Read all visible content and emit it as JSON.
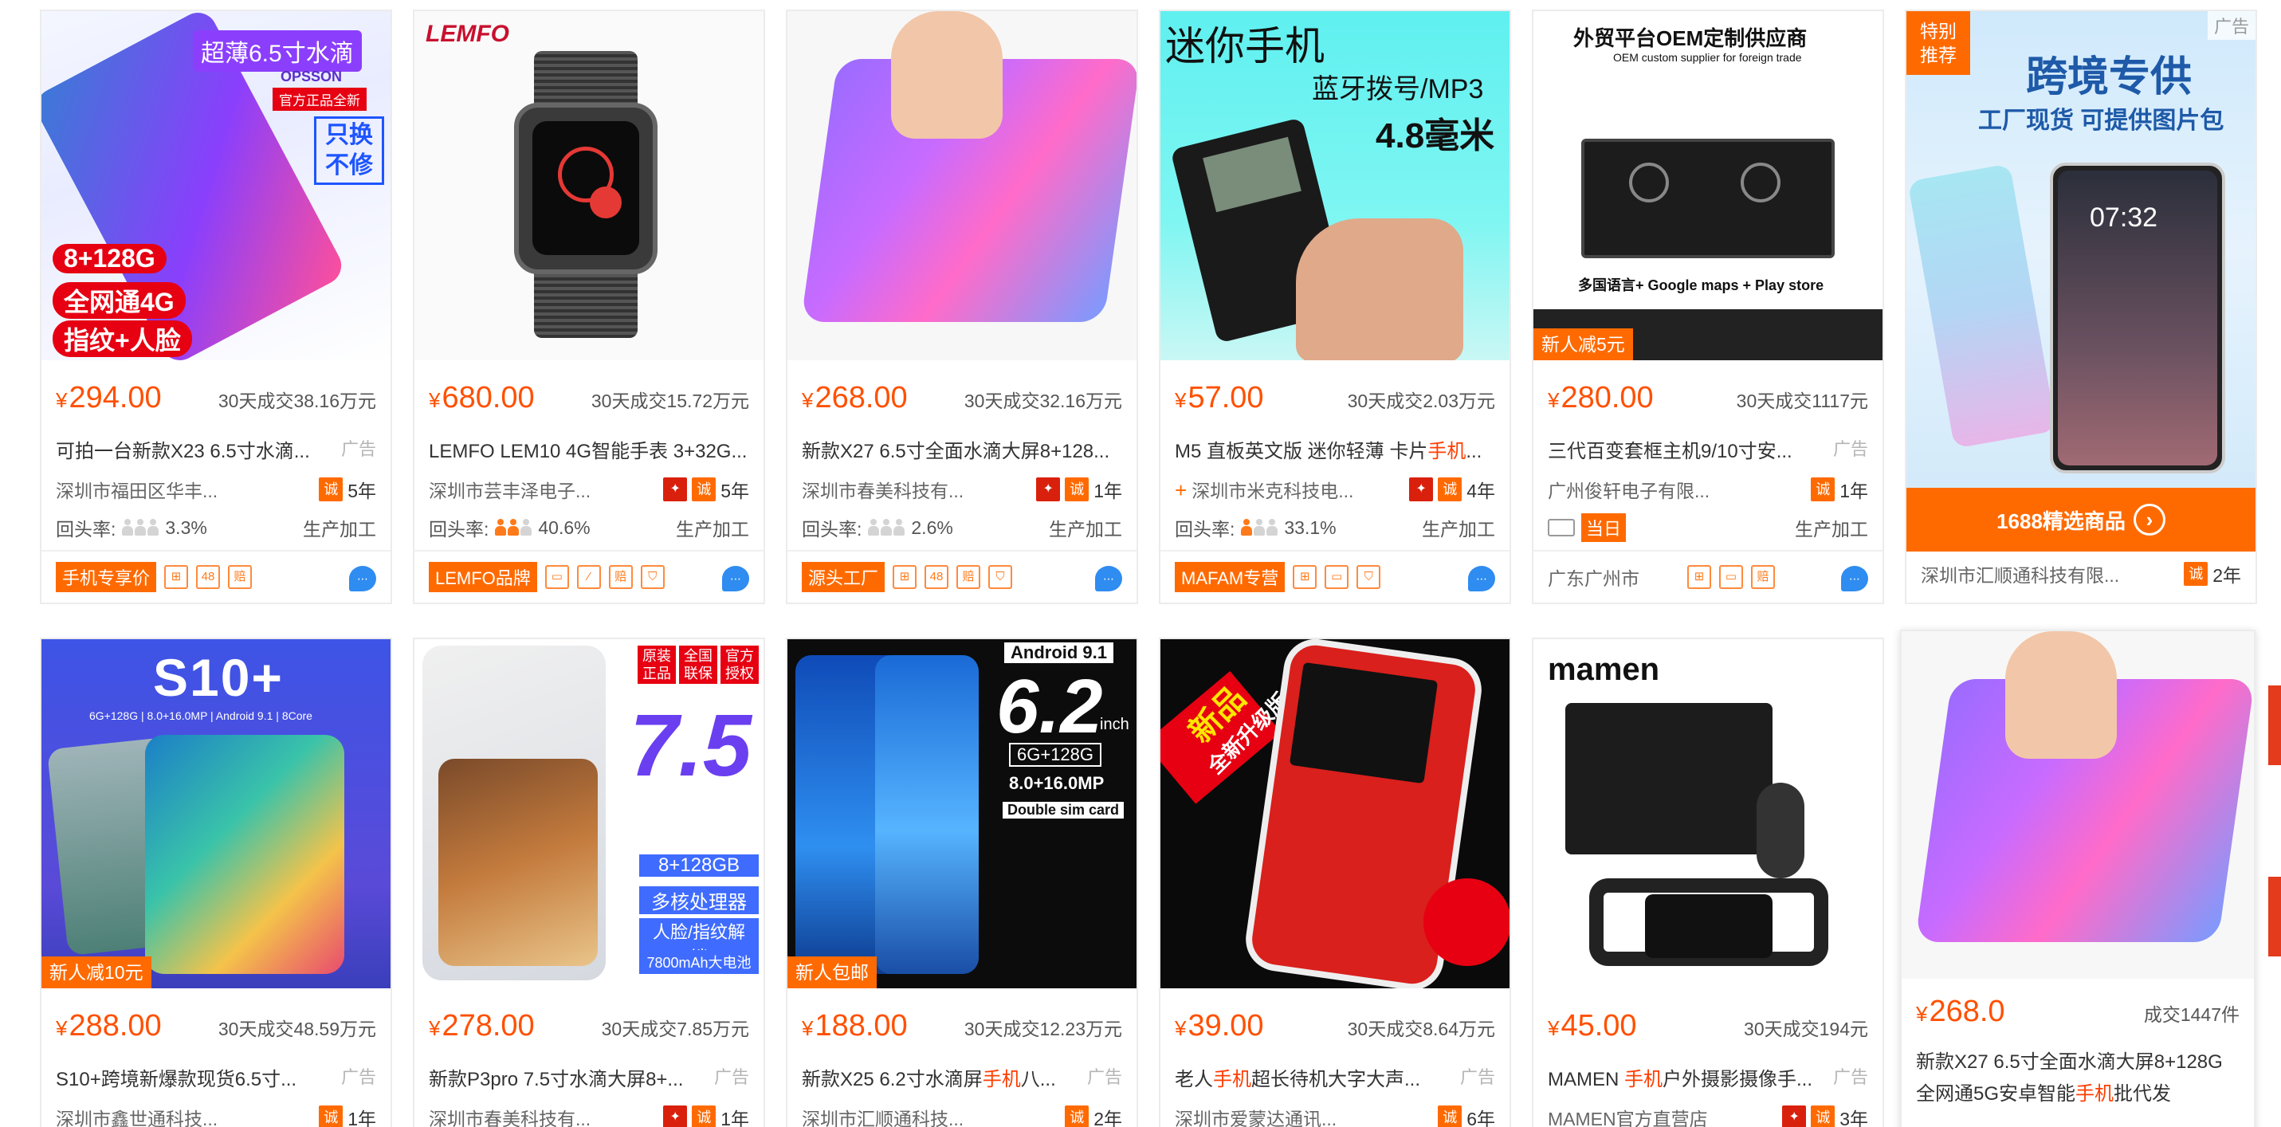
{
  "currency": "¥",
  "ad_label": "广告",
  "repurchase_label": "回头率:",
  "production_label": "生产加工",
  "row1": [
    {
      "price": "294.00",
      "sales": "30天成交38.16万元",
      "title": "可拍一台新款X23 6.5寸水滴...",
      "company": "深圳市福田区华丰...",
      "years": "5年",
      "rate": "3.3%",
      "foot_tag": "手机专享价",
      "services": [
        "⊞",
        "48",
        "赔"
      ],
      "img": {
        "line1": "超薄6.5寸水滴",
        "line2": "OPSSON",
        "line3": "官方正品全新",
        "line4": "只换",
        "line5": "不修",
        "spec1": "8+128G",
        "spec2": "全网通4G",
        "spec3": "指纹+人脸"
      }
    },
    {
      "price": "680.00",
      "sales": "30天成交15.72万元",
      "title": "LEMFO LEM10 4G智能手表 3+32G...",
      "company": "深圳市芸丰泽电子...",
      "years": "5年",
      "rate": "40.6%",
      "foot_tag": "LEMFO品牌",
      "services": [
        "▭",
        "⁄",
        "赔",
        "⛉"
      ],
      "img": {
        "brand": "LEMFO"
      }
    },
    {
      "price": "268.00",
      "sales": "30天成交32.16万元",
      "title": "新款X27 6.5寸全面水滴大屏8+128...",
      "company": "深圳市春美科技有...",
      "years": "1年",
      "rate": "2.6%",
      "foot_tag": "源头工厂",
      "services": [
        "⊞",
        "48",
        "赔",
        "⛉"
      ]
    },
    {
      "price": "57.00",
      "sales": "30天成交2.03万元",
      "title_pre": "M5 直板英文版 迷你轻薄 卡片",
      "title_hl": "手机",
      "title_post": "...",
      "company": "深圳市米克科技电...",
      "years": "4年",
      "rate": "33.1%",
      "foot_tag": "MAFAM专营",
      "services": [
        "⊞",
        "▭",
        "⛉"
      ],
      "img": {
        "line1": "迷你手机",
        "line2": "蓝牙拨号/MP3",
        "line3": "4.8毫米"
      }
    },
    {
      "price": "280.00",
      "sales": "30天成交1117元",
      "title": "三代百变套框主机9/10寸安...",
      "company": "广州俊轩电子有限...",
      "years": "1年",
      "same_day": "当日",
      "location": "广东广州市",
      "services": [
        "⊞",
        "▭",
        "赔"
      ],
      "img": {
        "line1": "外贸平台OEM定制供应商",
        "line2": "OEM custom supplier for foreign trade",
        "line3": "多国语言+ Google maps + Play store",
        "tag": "新人减5元"
      }
    },
    {
      "company": "深圳市汇顺通科技有限...",
      "years": "2年",
      "special1": "特别",
      "special2": "推荐",
      "img": {
        "line1": "跨境专供",
        "line2": "工厂现货 可提供图片包",
        "time": "07:32"
      },
      "banner": "1688精选商品"
    }
  ],
  "row2": [
    {
      "price": "288.00",
      "sales": "30天成交48.59万元",
      "title": "S10+跨境新爆款现货6.5寸...",
      "company": "深圳市鑫世通科技...",
      "years": "1年",
      "img": {
        "line1": "S10+",
        "line2": "6G+128G | 8.0+16.0MP | Android 9.1 | 8Core",
        "tag": "新人减10元"
      }
    },
    {
      "price": "278.00",
      "sales": "30天成交7.85万元",
      "title": "新款P3pro 7.5寸水滴大屏8+...",
      "company": "深圳市春美科技有...",
      "years": "1年",
      "img": {
        "b1": "原装正品",
        "b2": "全国联保",
        "b3": "官方授权",
        "big": "7.5",
        "s1": "8+128GB",
        "s2": "多核处理器",
        "s3": "人脸/指纹解锁",
        "s4": "7800mAh大电池"
      }
    },
    {
      "price": "188.00",
      "sales": "30天成交12.23万元",
      "title_pre": "新款X25 6.2寸水滴屏",
      "title_hl": "手机",
      "title_post": "八...",
      "company": "深圳市汇顺通科技...",
      "years": "2年",
      "img": {
        "line1": "Android 9.1",
        "big": "6.2",
        "unit": "inch",
        "s1": "6G+128G",
        "s2": "8.0+16.0MP",
        "s3": "Double sim card",
        "tag": "新人包邮"
      }
    },
    {
      "price": "39.00",
      "sales": "30天成交8.64万元",
      "title_pre": "老人",
      "title_hl": "手机",
      "title_post": "超长待机大字大声...",
      "company": "深圳市爱蒙达通讯...",
      "years": "6年",
      "img": {
        "line1": "新品",
        "line2": "全新升级版"
      }
    },
    {
      "price": "45.00",
      "sales": "30天成交194元",
      "title_pre": "MAMEN ",
      "title_hl": "手机",
      "title_post": "户外摄影摄像手...",
      "company": "MAMEN官方直营店",
      "years": "3年",
      "img": {
        "brand": "mamen"
      }
    },
    {
      "price": "268.0",
      "sales": "成交1447件",
      "title": "新款X27 6.5寸全面水滴大屏8+128G",
      "title2_pre": "全网通5G安卓智能",
      "title2_hl": "手机",
      "title2_post": "批代发"
    }
  ]
}
